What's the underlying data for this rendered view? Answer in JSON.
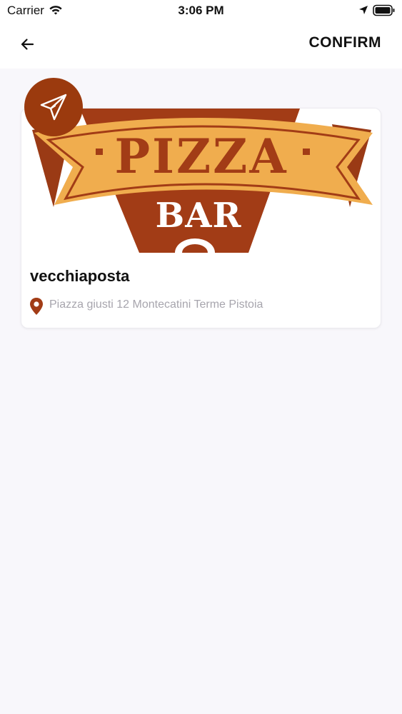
{
  "status_bar": {
    "carrier": "Carrier",
    "time": "3:06 PM"
  },
  "header": {
    "back_icon": "arrow-left-icon",
    "confirm_label": "CONFIRM"
  },
  "restaurant": {
    "logo_text_top": "PIZZA",
    "logo_text_bottom": "BAR",
    "name": "vecchiaposta",
    "address": "Piazza giusti 12 Montecatini Terme Pistoia"
  },
  "colors": {
    "accent": "#9b3a0e",
    "logo_orange": "#f0ad4e",
    "logo_brown": "#a23c16",
    "address_gray": "#a7a5ad",
    "background": "#f8f7fb"
  },
  "icons": {
    "badge": "paper-plane-icon",
    "address": "map-pin-icon"
  }
}
